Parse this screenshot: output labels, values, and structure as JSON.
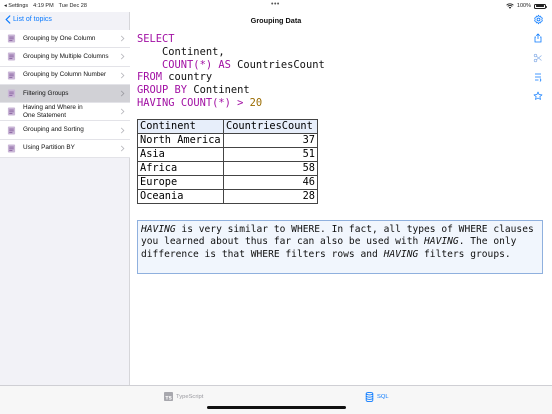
{
  "status_bar": {
    "carrier": "◂ Settings",
    "time": "4:19 PM",
    "date": "Tue Dec 28",
    "dots": "•••",
    "battery": "100%"
  },
  "sidebar": {
    "back_label": "List of topics",
    "items": [
      {
        "label": "Grouping by One Column",
        "selected": false
      },
      {
        "label": "Grouping by Multiple Columns",
        "selected": false
      },
      {
        "label": "Grouping by Column Number",
        "selected": false
      },
      {
        "label": "Filtering Groups",
        "selected": true
      },
      {
        "label": "Having and Where in One Statement",
        "selected": false
      },
      {
        "label": "Grouping and Sorting",
        "selected": false
      },
      {
        "label": "Using Partition BY",
        "selected": false
      }
    ]
  },
  "header": {
    "title": "Grouping Data"
  },
  "toolbar_icons": [
    "settings-icon",
    "share-icon",
    "scissors-icon",
    "text-format-icon",
    "star-icon"
  ],
  "query": {
    "select": "SELECT",
    "col1": "Continent,",
    "count": "COUNT(*)",
    "as": "AS",
    "alias": "CountriesCount",
    "from": "FROM",
    "table": "country",
    "group_by": "GROUP BY",
    "group_col": "Continent",
    "having": "HAVING",
    "having_expr": "COUNT(*) >",
    "having_value": "20"
  },
  "result": {
    "columns": [
      "Continent",
      "CountriesCount"
    ],
    "rows": [
      [
        "North America",
        "37"
      ],
      [
        "Asia",
        "51"
      ],
      [
        "Africa",
        "58"
      ],
      [
        "Europe",
        "46"
      ],
      [
        "Oceania",
        "28"
      ]
    ]
  },
  "note": {
    "having1": "HAVING",
    "text1": " is very similar to WHERE. In fact, all types of WHERE clauses you learned about thus far can also be used with ",
    "having2": "HAVING",
    "text2": ". The only difference is that WHERE filters rows and ",
    "having3": "HAVING",
    "text3": " filters groups."
  },
  "tabs": {
    "typescript": "TypeScript",
    "sql": "SQL",
    "active": "SQL"
  },
  "colors": {
    "accent": "#0a7aff",
    "keyword": "#a10fa3",
    "number": "#9a6b00",
    "note_bg": "#f1f6fd",
    "note_border": "#8fb0de"
  }
}
